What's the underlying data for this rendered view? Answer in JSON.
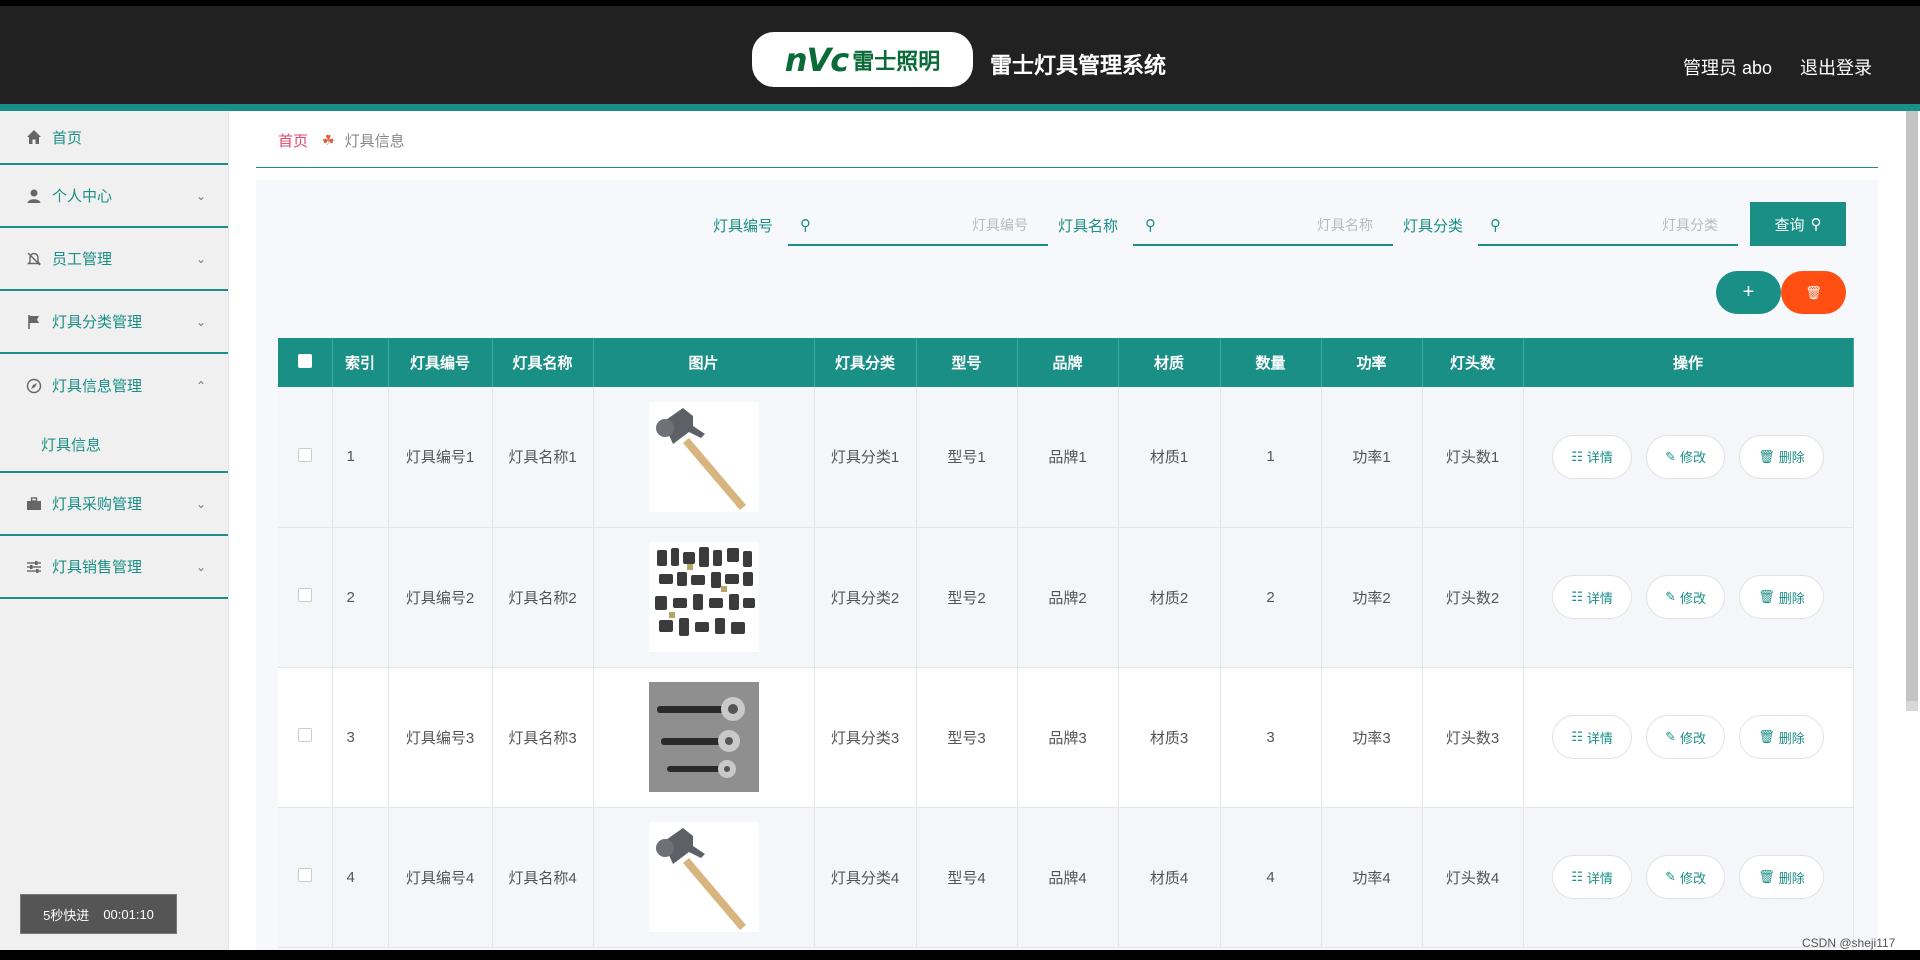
{
  "header": {
    "logo_mark": "nVc",
    "logo_text": "雷士照明",
    "title": "雷士灯具管理系统",
    "admin": "管理员 abo",
    "logout": "退出登录"
  },
  "sidebar": {
    "items": [
      {
        "label": "首页",
        "icon": "home-icon"
      },
      {
        "label": "个人中心",
        "icon": "user-icon"
      },
      {
        "label": "员工管理",
        "icon": "bell-off-icon"
      },
      {
        "label": "灯具分类管理",
        "icon": "flag-icon"
      },
      {
        "label": "灯具信息管理",
        "icon": "compass-icon"
      },
      {
        "label": "灯具采购管理",
        "icon": "briefcase-icon"
      },
      {
        "label": "灯具销售管理",
        "icon": "sliders-icon"
      }
    ],
    "submenu": {
      "label": "灯具信息"
    }
  },
  "speed": {
    "label": "5秒快进",
    "time": "00:01:10"
  },
  "breadcrumb": {
    "home": "首页",
    "current": "灯具信息"
  },
  "search": {
    "field1": {
      "label": "灯具编号",
      "placeholder": "灯具编号"
    },
    "field2": {
      "label": "灯具名称",
      "placeholder": "灯具名称"
    },
    "field3": {
      "label": "灯具分类",
      "placeholder": "灯具分类"
    },
    "query_label": "查询"
  },
  "actions": {
    "add": "+",
    "delete": "🗑"
  },
  "table": {
    "headers": [
      "索引",
      "灯具编号",
      "灯具名称",
      "图片",
      "灯具分类",
      "型号",
      "品牌",
      "材质",
      "数量",
      "功率",
      "灯头数",
      "操作"
    ],
    "ops": {
      "detail": "详情",
      "edit": "修改",
      "delete": "删除"
    },
    "rows": [
      {
        "idx": "1",
        "code": "灯具编号1",
        "name": "灯具名称1",
        "img": "hammer",
        "category": "灯具分类1",
        "model": "型号1",
        "brand": "品牌1",
        "material": "材质1",
        "qty": "1",
        "power": "功率1",
        "heads": "灯头数1"
      },
      {
        "idx": "2",
        "code": "灯具编号2",
        "name": "灯具名称2",
        "img": "parts",
        "category": "灯具分类2",
        "model": "型号2",
        "brand": "品牌2",
        "material": "材质2",
        "qty": "2",
        "power": "功率2",
        "heads": "灯头数2"
      },
      {
        "idx": "3",
        "code": "灯具编号3",
        "name": "灯具名称3",
        "img": "wrenches",
        "category": "灯具分类3",
        "model": "型号3",
        "brand": "品牌3",
        "material": "材质3",
        "qty": "3",
        "power": "功率3",
        "heads": "灯头数3"
      },
      {
        "idx": "4",
        "code": "灯具编号4",
        "name": "灯具名称4",
        "img": "hammer",
        "category": "灯具分类4",
        "model": "型号4",
        "brand": "品牌4",
        "material": "材质4",
        "qty": "4",
        "power": "功率4",
        "heads": "灯头数4"
      }
    ]
  },
  "watermark": "CSDN @sheji117"
}
